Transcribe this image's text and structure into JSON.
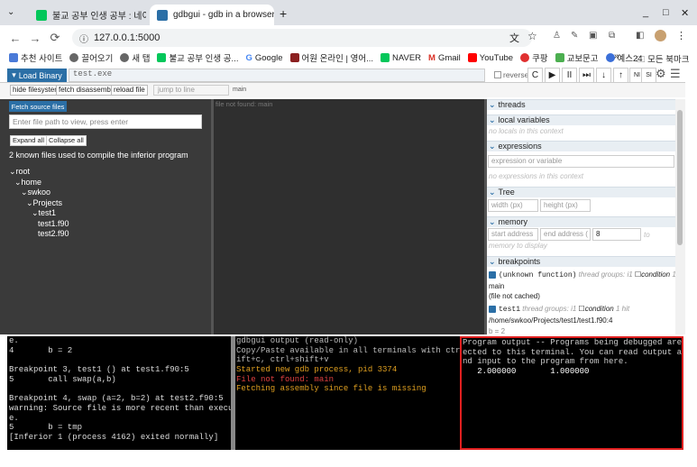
{
  "browser": {
    "tabs": [
      {
        "label": "불교 공부 인생 공부 : 네이버 블",
        "active": false
      },
      {
        "label": "gdbgui - gdb in a browser",
        "active": true
      }
    ],
    "new_tab": "+",
    "window_controls": [
      "_",
      "□",
      "✕"
    ],
    "url": "127.0.0.1:5000",
    "bookmarks": [
      "추천 사이트",
      "끌어오기",
      "새 탭",
      "불교 공부 인생 공...",
      "Google",
      "어원 온라인 | 영어...",
      "NAVER",
      "Gmail",
      "YouTube",
      "쿠팡",
      "교보문고",
      "예스24"
    ],
    "all_bookmarks": "모든 북마크"
  },
  "gdbgui": {
    "load_binary": "Load Binary",
    "binary_value": "test.exe",
    "reverse_label": "reverse",
    "right_buttons": [
      "C",
      "▶",
      "II",
      "⏭",
      "↓",
      "↑",
      "NI",
      "SI",
      "⚙",
      "☰"
    ],
    "sub_buttons": [
      "hide filesystem",
      "fetch disassembly",
      "reload file"
    ],
    "jump_placeholder": "jump to line",
    "func_label": "main",
    "file_panel": {
      "fetch_sources": "Fetch source files",
      "path_placeholder": "Enter file path to view, press enter",
      "expand_all": "Expand all",
      "collapse_all": "Collapse all",
      "known_files": "2 known files used to compile the inferior program",
      "tree": [
        "root",
        "home",
        "swkoo",
        "Projects",
        "test1",
        "test1.f90",
        "test2.f90"
      ]
    },
    "source_message": "file not found: main",
    "right_panel": {
      "threads": "threads",
      "local_variables": "local variables",
      "no_locals": "no locals in this context",
      "expressions": "expressions",
      "expr_placeholder": "expression or variable",
      "no_expressions": "no expressions in this context",
      "tree": "Tree",
      "tree_width": "width (px)",
      "tree_height": "height (px)",
      "memory": "memory",
      "mem_start": "start address",
      "mem_end": "end address (",
      "mem_count": "8",
      "mem_to": "to",
      "no_memory": "memory to display",
      "breakpoints": "breakpoints",
      "bp1_func": "(unknown function)",
      "bp1_meta": "thread groups: i1",
      "bp1_cond": "condition",
      "bp1_hits": "1 hit",
      "bp1_name": "main",
      "bp1_file": "(file not cached)",
      "bp2_func": "test1",
      "bp2_meta": "thread groups: i1",
      "bp2_cond": "condition",
      "bp2_hits": "1 hit",
      "bp2_path": "/home/swkoo/Projects/test1/test1.f90:4",
      "bp2_code": "b = 2"
    },
    "gdb_terminal": [
      "e.",
      "4       b = 2",
      "",
      "Breakpoint 3, test1 () at test1.f90:5",
      "5       call swap(a,b)",
      "",
      "Breakpoint 4, swap (a=2, b=2) at test2.f90:5",
      "warning: Source file is more recent than executabl",
      "e.",
      "5       b = tmp",
      "[Inferior 1 (process 4162) exited normally]"
    ],
    "output_terminal": [
      "gdbgui output (read-only)",
      "Copy/Paste available in all terminals with ctrl+sh",
      "ift+c, ctrl+shift+v",
      "Started new gdb process, pid 3374",
      "File not found: main",
      "Fetching assembly since file is missing"
    ],
    "program_terminal": [
      "Program output -- Programs being debugged are conn",
      "ected to this terminal. You can read output and se",
      "nd input to the program from here.",
      "   2.000000       1.000000"
    ]
  }
}
